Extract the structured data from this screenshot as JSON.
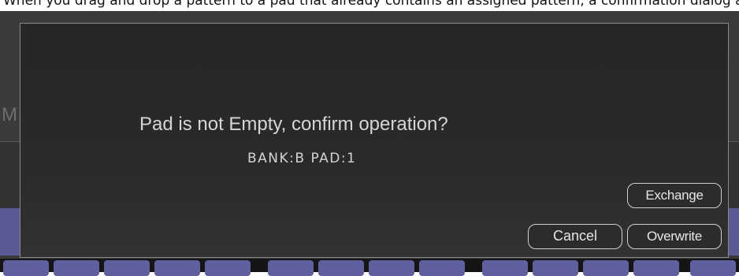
{
  "caption": {
    "text": "When you drag and drop a pattern to a pad that already contains an assigned pattern, a confirmation dialog appears."
  },
  "background": {
    "partial_label": "M",
    "pad_count": 14
  },
  "dialog": {
    "message": "Pad is not Empty, confirm operation?",
    "detail": "BANK:B PAD:1",
    "buttons": {
      "exchange": "Exchange",
      "cancel": "Cancel",
      "overwrite": "Overwrite"
    }
  },
  "colors": {
    "dialog_bg": "#2a2a2a",
    "dialog_border": "#8a8a8a",
    "text": "#d6d6d6",
    "button_border": "#d0d0d0",
    "pad_accent": "#5f5fa0"
  }
}
